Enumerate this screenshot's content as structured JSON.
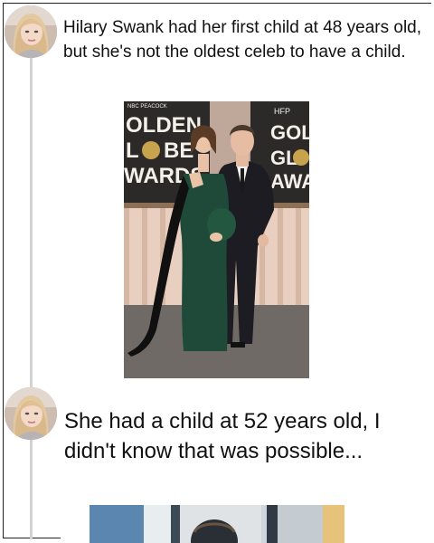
{
  "thread": {
    "posts": [
      {
        "avatar": "user-avatar",
        "text": "Hilary Swank had her first child at 48 years old, but she's not the oldest celeb to have a child.",
        "image": {
          "subject": "red-carpet-photo",
          "backdrop_left_text": [
            "OLDEN",
            "L",
            "BE",
            "WARDS"
          ],
          "backdrop_right_text": [
            "GOLD",
            "GL",
            "AWAR"
          ],
          "top_logo_text": "HFP",
          "network_text": "NBC PEACOCK"
        }
      },
      {
        "avatar": "user-avatar",
        "text": "She had a child at 52 years old, I didn't know that was possible...",
        "image": {
          "subject": "partial-photo"
        }
      }
    ]
  }
}
